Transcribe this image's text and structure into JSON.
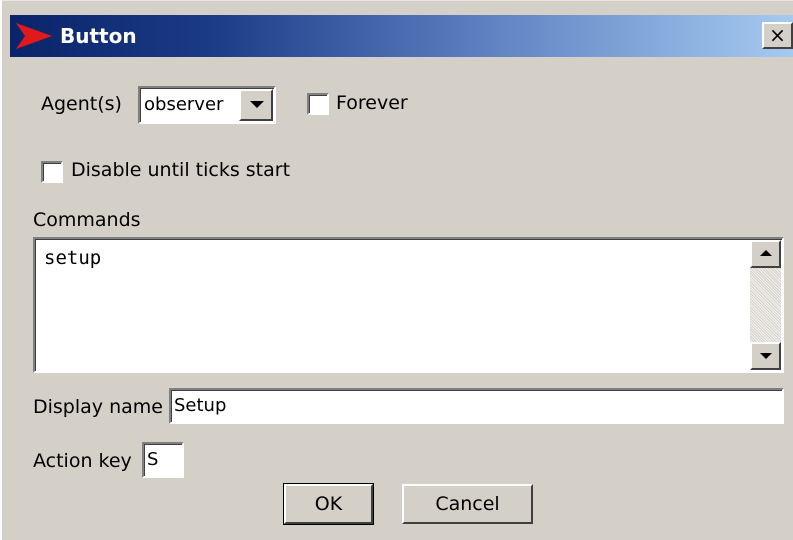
{
  "window": {
    "title": "Button",
    "close_glyph": "×",
    "logo_icon": "netlogo-red-arrow-icon",
    "title_gradient": [
      "#0a246a",
      "#a6caf0"
    ]
  },
  "agents": {
    "label": "Agent(s)",
    "value": "observer"
  },
  "forever": {
    "label": "Forever",
    "checked": false
  },
  "disable_until_ticks": {
    "label": "Disable until ticks start",
    "checked": false
  },
  "commands": {
    "label": "Commands",
    "value": "setup"
  },
  "display_name": {
    "label": "Display name",
    "value": "Setup"
  },
  "action_key": {
    "label": "Action key",
    "value": "S"
  },
  "buttons": {
    "ok_label": "OK",
    "cancel_label": "Cancel"
  },
  "colors": {
    "dialog_face": "#d4d0c8",
    "logo_red": "#e01a1a"
  }
}
